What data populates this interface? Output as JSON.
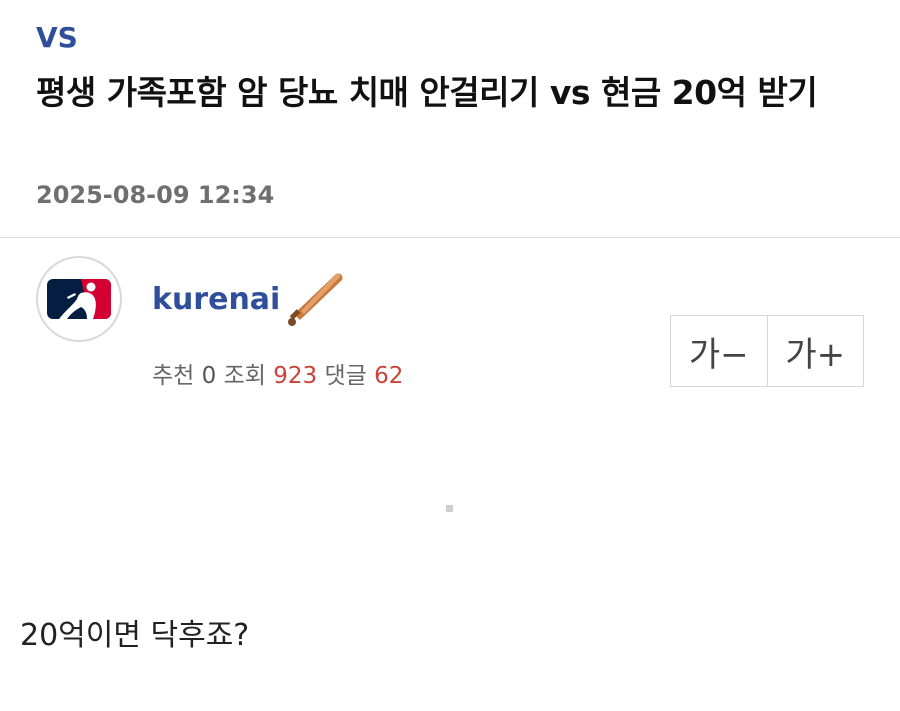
{
  "post": {
    "category": "VS",
    "title": "평생 가족포함 암 당뇨 치매 안걸리기 vs 현금 20억 받기",
    "date": "2025-08-09 12:34",
    "body": "20억이면 닥후죠?"
  },
  "author": {
    "name": "kurenai",
    "avatar_icon": "mlb-logo-icon",
    "badge_icon": "baseball-bat-icon"
  },
  "stats": {
    "recommend_label": "추천",
    "recommend_value": "0",
    "views_label": "조회",
    "views_value": "923",
    "comments_label": "댓글",
    "comments_value": "62"
  },
  "font_controls": {
    "decrease_label": "가−",
    "increase_label": "가+"
  },
  "colors": {
    "accent_blue": "#2f4f9a",
    "count_red": "#c9433a",
    "mlb_red": "#d50032",
    "mlb_navy": "#041e42"
  }
}
